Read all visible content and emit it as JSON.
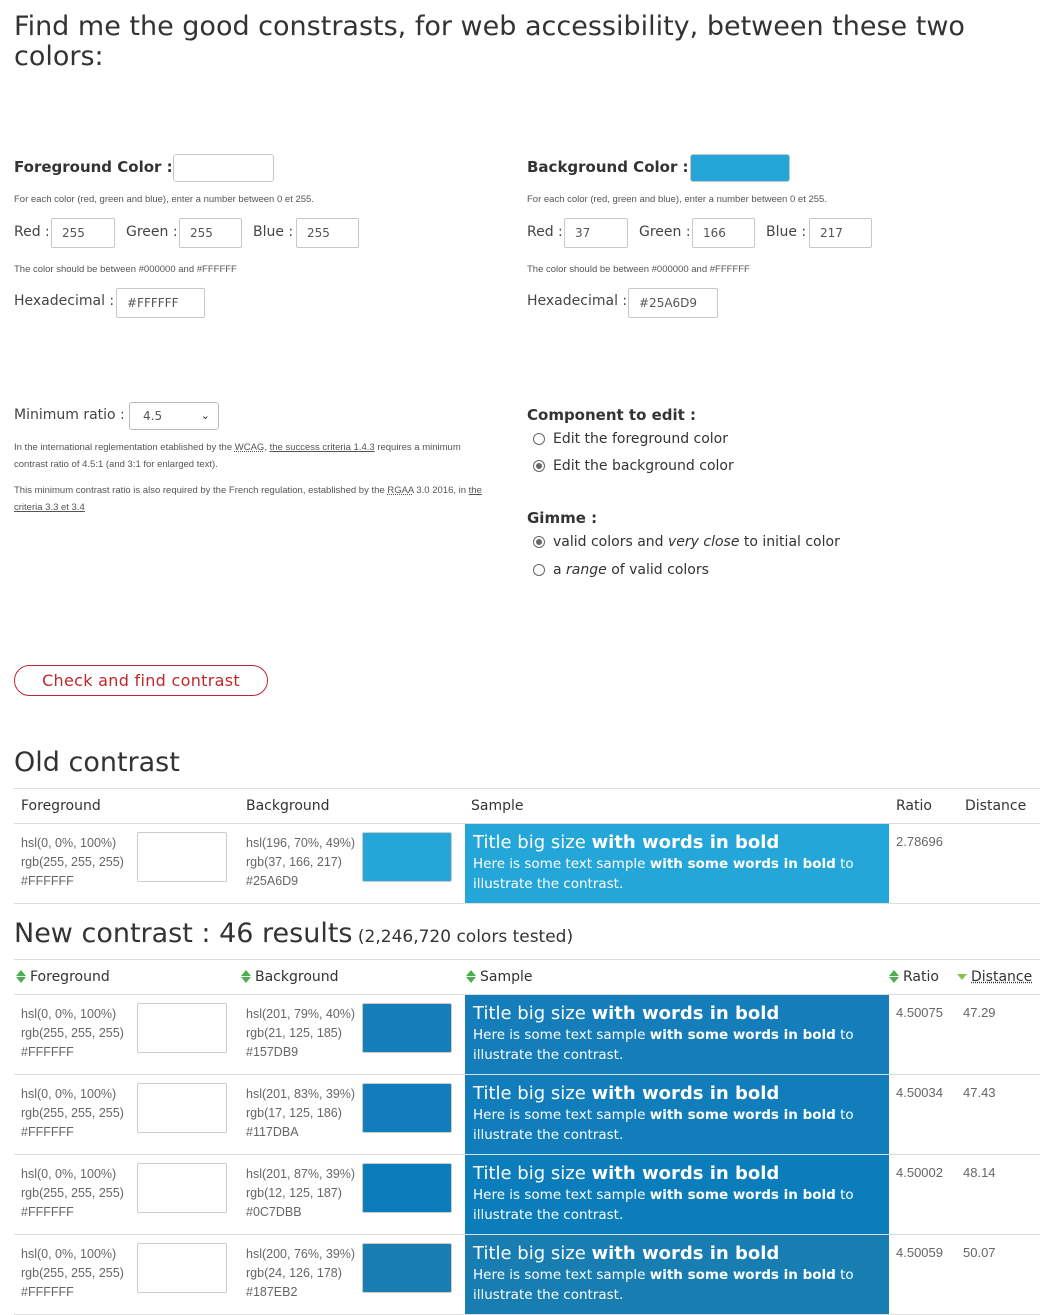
{
  "page": {
    "title": "Find me the good constrasts, for web accessibility, between these two colors:"
  },
  "foreground": {
    "label": "Foreground Color :",
    "swatch": "#FFFFFF",
    "help": "For each color (red, green and blue), enter a number between 0 et 255.",
    "red_label": "Red :",
    "red": "255",
    "green_label": "Green :",
    "green": "255",
    "blue_label": "Blue :",
    "blue": "255",
    "hex_help": "The color should be between #000000 and #FFFFFF",
    "hex_label": "Hexadecimal :",
    "hex": "#FFFFFF"
  },
  "background": {
    "label": "Background Color :",
    "swatch": "#25A6D9",
    "help": "For each color (red, green and blue), enter a number between 0 et 255.",
    "red_label": "Red :",
    "red": "37",
    "green_label": "Green :",
    "green": "166",
    "blue_label": "Blue :",
    "blue": "217",
    "hex_help": "The color should be between #000000 and #FFFFFF",
    "hex_label": "Hexadecimal :",
    "hex": "#25A6D9"
  },
  "ratio": {
    "label": "Minimum ratio :",
    "selected": "4.5",
    "help1_pre": "In the international reglementation etablished by the ",
    "help1_abbr": "WCAG",
    "help1_sep": ", ",
    "help1_link": "the success criteria 1.4.3",
    "help1_post": " requires a minimum contrast ratio of 4.5:1 (and 3:1 for enlarged text).",
    "help2_pre": "This minimum contrast ratio is also required by the French regulation, established by the ",
    "help2_abbr": "RGAA",
    "help2_mid": " 3.0 2016, in ",
    "help2_link": "the criteria 3.3 et 3.4"
  },
  "component": {
    "label": "Component to edit :",
    "options": [
      {
        "label": "Edit the foreground color",
        "checked": false
      },
      {
        "label": "Edit the background color",
        "checked": true
      }
    ]
  },
  "gimme": {
    "label": "Gimme :",
    "opt1_a": "valid colors and ",
    "opt1_em": "very close",
    "opt1_b": " to initial color",
    "opt2_a": "a ",
    "opt2_em": "range",
    "opt2_b": " of valid colors"
  },
  "check_button": "Check and find contrast",
  "old_contrast": {
    "title": "Old contrast",
    "headers": {
      "foreground": "Foreground",
      "background": "Background",
      "sample": "Sample",
      "ratio": "Ratio",
      "distance": "Distance"
    },
    "row": {
      "fg_hsl": "hsl(0, 0%, 100%)",
      "fg_rgb": "rgb(255, 255, 255)",
      "fg_hex": "#FFFFFF",
      "fg_color": "#FFFFFF",
      "bg_hsl": "hsl(196, 70%, 49%)",
      "bg_rgb": "rgb(37, 166, 217)",
      "bg_hex": "#25A6D9",
      "bg_color": "#25A6D9",
      "ratio": "2.78696",
      "distance": ""
    }
  },
  "sample_text": {
    "big_a": "Title big size ",
    "big_b": "with words in bold",
    "small_a": "Here is some text sample ",
    "small_b": "with some words in bold",
    "small_c": " to illustrate the contrast."
  },
  "new_contrast": {
    "title_a": "New contrast : 46 results",
    "title_b": " (2,246,720 colors tested)",
    "headers": {
      "foreground": "Foreground",
      "background": "Background",
      "sample": "Sample",
      "ratio": "Ratio",
      "distance": "Distance"
    },
    "rows": [
      {
        "fg_hsl": "hsl(0, 0%, 100%)",
        "fg_rgb": "rgb(255, 255, 255)",
        "fg_hex": "#FFFFFF",
        "fg_color": "#FFFFFF",
        "bg_hsl": "hsl(201, 79%, 40%)",
        "bg_rgb": "rgb(21, 125, 185)",
        "bg_hex": "#157DB9",
        "bg_color": "#157DB9",
        "ratio": "4.50075",
        "distance": "47.29"
      },
      {
        "fg_hsl": "hsl(0, 0%, 100%)",
        "fg_rgb": "rgb(255, 255, 255)",
        "fg_hex": "#FFFFFF",
        "fg_color": "#FFFFFF",
        "bg_hsl": "hsl(201, 83%, 39%)",
        "bg_rgb": "rgb(17, 125, 186)",
        "bg_hex": "#117DBA",
        "bg_color": "#117DBA",
        "ratio": "4.50034",
        "distance": "47.43"
      },
      {
        "fg_hsl": "hsl(0, 0%, 100%)",
        "fg_rgb": "rgb(255, 255, 255)",
        "fg_hex": "#FFFFFF",
        "fg_color": "#FFFFFF",
        "bg_hsl": "hsl(201, 87%, 39%)",
        "bg_rgb": "rgb(12, 125, 187)",
        "bg_hex": "#0C7DBB",
        "bg_color": "#0C7DBB",
        "ratio": "4.50002",
        "distance": "48.14"
      },
      {
        "fg_hsl": "hsl(0, 0%, 100%)",
        "fg_rgb": "rgb(255, 255, 255)",
        "fg_hex": "#FFFFFF",
        "fg_color": "#FFFFFF",
        "bg_hsl": "hsl(200, 76%, 39%)",
        "bg_rgb": "rgb(24, 126, 178)",
        "bg_hex": "#187EB2",
        "bg_color": "#187EB2",
        "ratio": "4.50059",
        "distance": "50.07"
      }
    ]
  }
}
